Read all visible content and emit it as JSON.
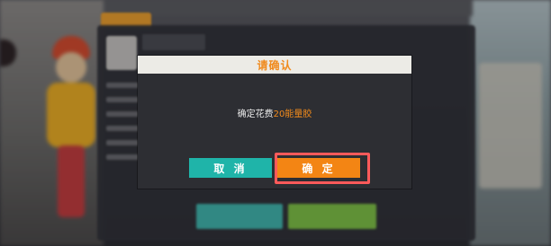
{
  "dialog": {
    "title": "请确认",
    "message_prefix": "确定花费",
    "message_amount": "20能量胶",
    "cancel_label": "取 消",
    "confirm_label": "确 定"
  },
  "colors": {
    "accent_orange": "#f38514",
    "cancel_teal": "#1fb4a9",
    "highlight_red": "#ff5a5a",
    "dialog_bg": "#2d2e33",
    "header_bg": "#ecebe6"
  }
}
